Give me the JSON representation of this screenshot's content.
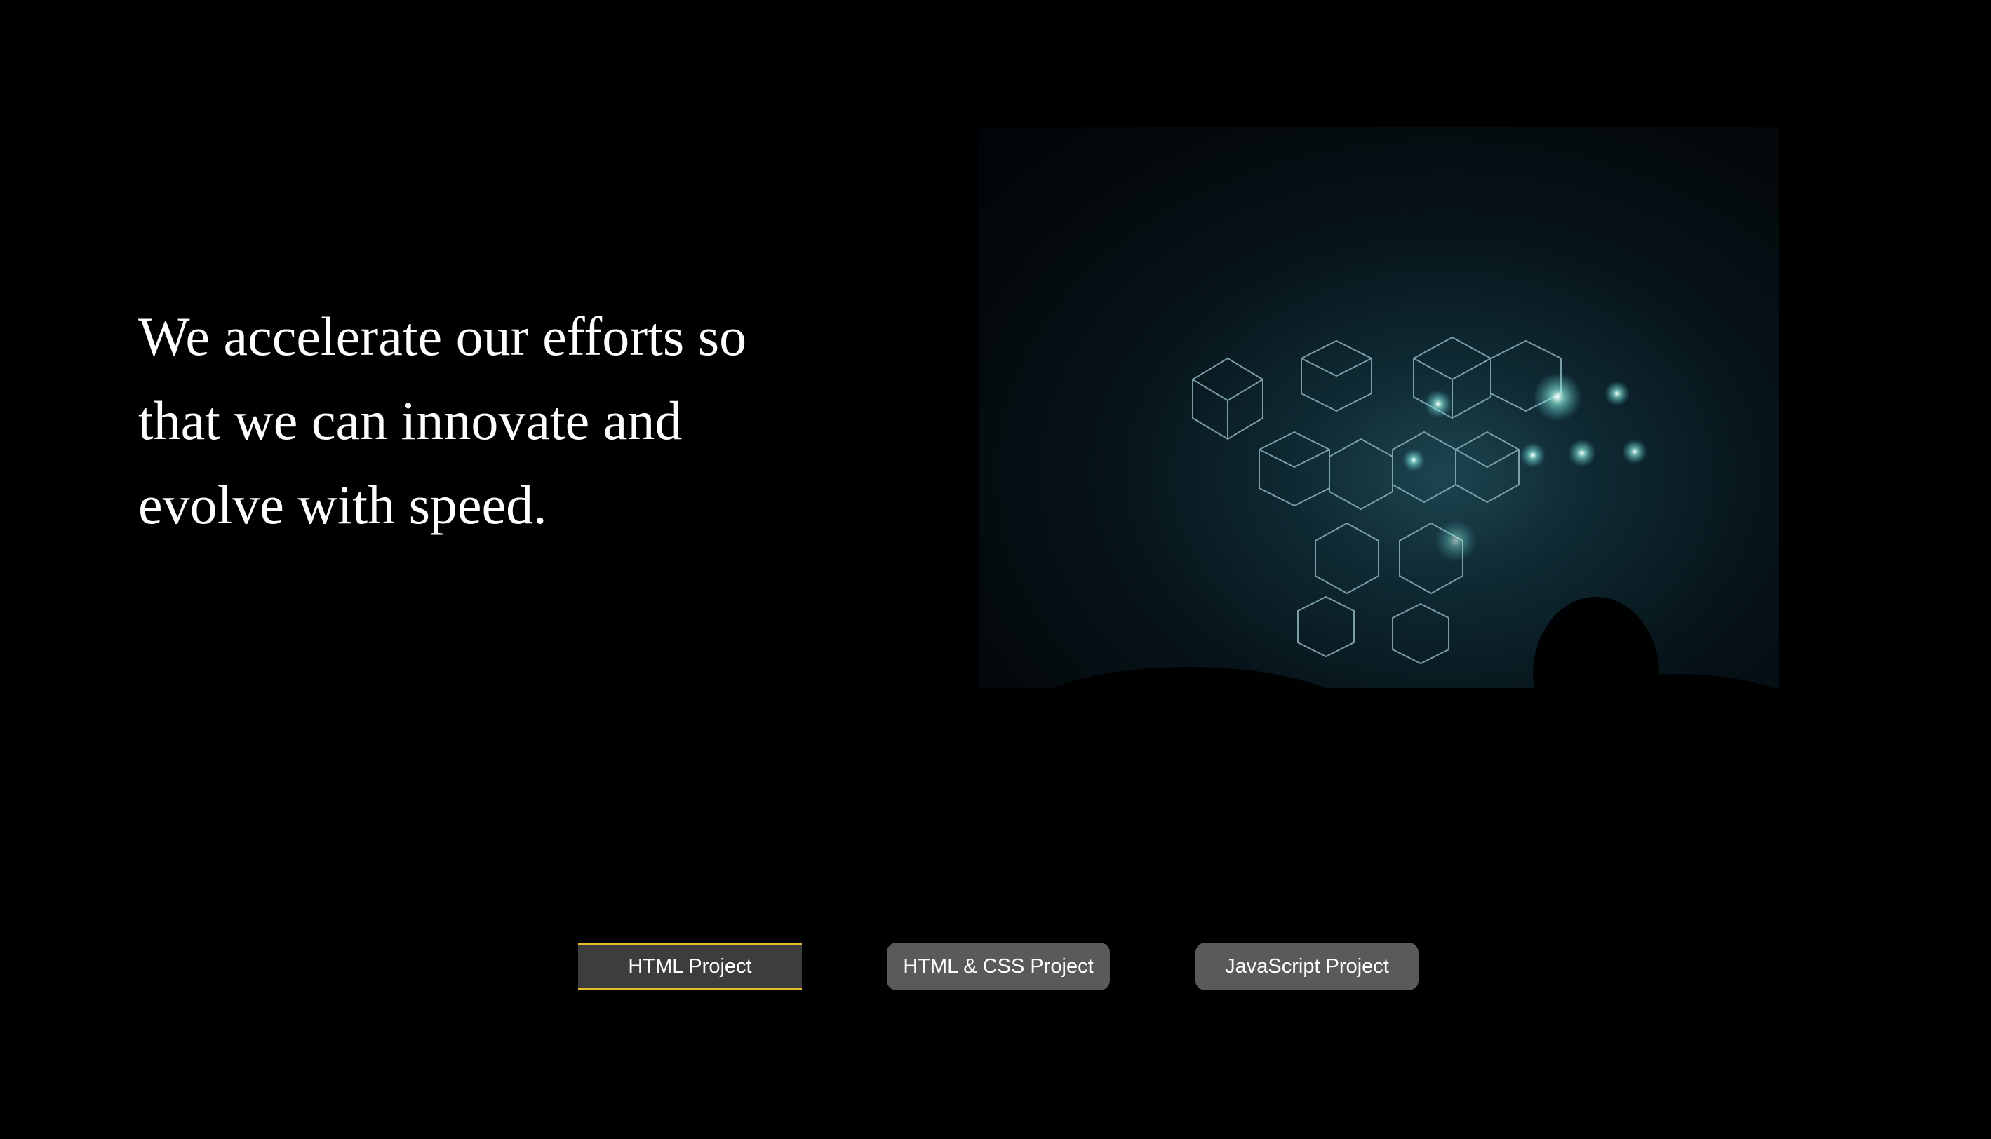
{
  "headline": "We accelerate our efforts so that we can innovate and evolve with speed.",
  "hero_image": {
    "alt": "Concert stage with glowing geometric cube light installation"
  },
  "tabs": [
    {
      "label": "HTML Project",
      "active": true
    },
    {
      "label": "HTML & CSS Project",
      "active": false
    },
    {
      "label": "JavaScript Project",
      "active": false
    }
  ],
  "colors": {
    "background": "#000000",
    "tab_active_border": "#e5bd2f",
    "tab_bg": "#5a5a5a",
    "tab_active_bg": "#3d3d3d"
  }
}
